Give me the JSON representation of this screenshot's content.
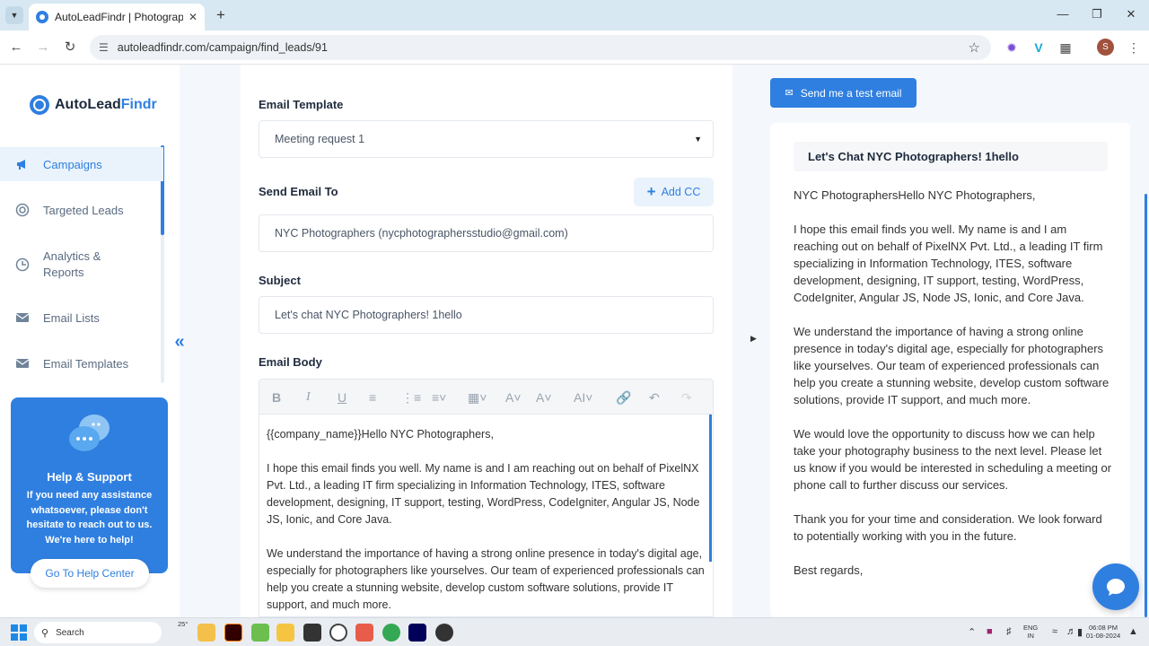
{
  "browser": {
    "tab_title": "AutoLeadFindr | Photographers",
    "url": "autoleadfindr.com/campaign/find_leads/91",
    "profile_initial": "S"
  },
  "sidebar": {
    "logo_part1": "AutoLead",
    "logo_part2": "Findr",
    "items": [
      {
        "label": "Campaigns",
        "icon": "megaphone-icon"
      },
      {
        "label": "Targeted Leads",
        "icon": "target-icon"
      },
      {
        "label": "Analytics & Reports",
        "icon": "analytics-icon"
      },
      {
        "label": "Email Lists",
        "icon": "mail-icon"
      },
      {
        "label": "Email Templates",
        "icon": "template-icon"
      }
    ],
    "help": {
      "title": "Help & Support",
      "text": "If you need any assistance whatsoever, please don't hesitate to reach out to us. We're here to help!",
      "button": "Go To Help Center"
    }
  },
  "form": {
    "template_label": "Email Template",
    "template_value": "Meeting request 1",
    "send_to_label": "Send Email To",
    "add_cc": "Add CC",
    "send_to_value": "NYC Photographers (nycphotographersstudio@gmail.com)",
    "subject_label": "Subject",
    "subject_value": "Let's chat NYC Photographers! 1hello",
    "body_label": "Email Body",
    "body": [
      "{{company_name}}Hello NYC Photographers,",
      "I hope this email finds you well. My name is and I am reaching out on behalf of PixelNX Pvt. Ltd., a leading IT firm specializing in Information Technology, ITES, software development, designing, IT support, testing, WordPress, CodeIgniter, Angular JS, Node JS, Ionic, and Core Java.",
      "We understand the importance of having a strong online presence in today's digital age, especially for photographers like yourselves. Our team of experienced professionals can help you create a stunning website, develop custom software solutions, provide IT support, and much more."
    ]
  },
  "preview": {
    "test_button": "Send me a test email",
    "subject": "Let's Chat NYC Photographers! 1hello",
    "paragraphs": [
      "NYC PhotographersHello NYC Photographers,",
      "I hope this email finds you well. My name is and I am reaching out on behalf of PixelNX Pvt. Ltd., a leading IT firm specializing in Information Technology, ITES, software development, designing, IT support, testing, WordPress, CodeIgniter, Angular JS, Node JS, Ionic, and Core Java.",
      "We understand the importance of having a strong online presence in today's digital age, especially for photographers like yourselves. Our team of experienced professionals can help you create a stunning website, develop custom software solutions, provide IT support, and much more.",
      "We would love the opportunity to discuss how we can help take your photography business to the next level. Please let us know if you would be interested in scheduling a meeting or phone call to further discuss our services.",
      "Thank you for your time and consideration. We look forward to potentially working with you in the future.",
      "Best regards,"
    ]
  },
  "taskbar": {
    "search_placeholder": "Search",
    "weather": "25°",
    "lang_line1": "ENG",
    "lang_line2": "IN",
    "time": "06:08 PM",
    "date": "01-08-2024"
  },
  "colors": {
    "accent": "#2f7fe0",
    "main_bg": "#f4f8fc"
  }
}
